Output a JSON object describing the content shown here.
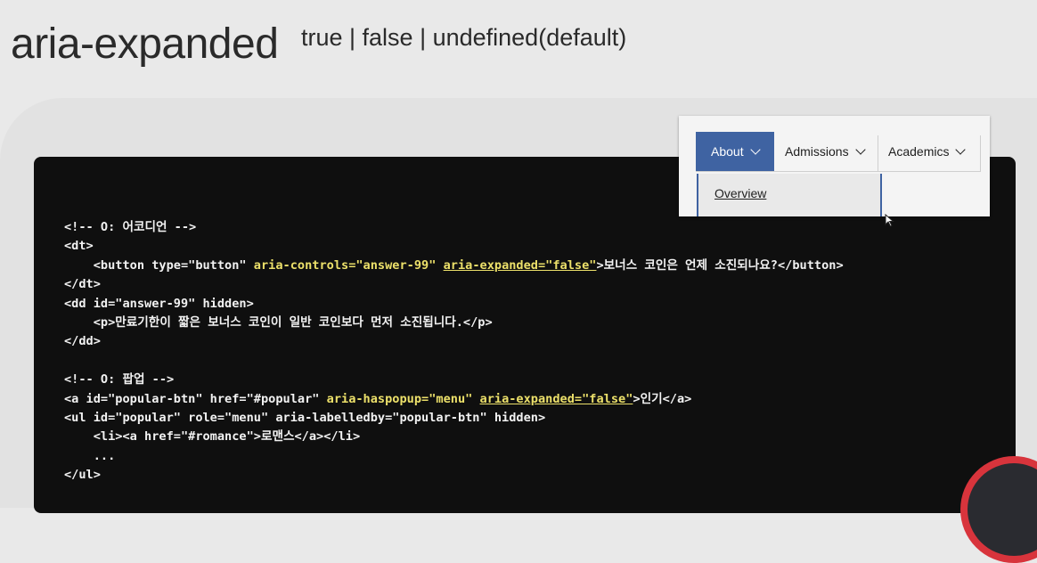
{
  "title": "aria-expanded",
  "subtitle": "true | false | undefined(default)",
  "demo": {
    "nav": [
      {
        "label": "About",
        "active": true
      },
      {
        "label": "Admissions",
        "active": false
      },
      {
        "label": "Academics",
        "active": false
      }
    ],
    "dropdown_item": "Overview",
    "colors": {
      "active": "#3f63a2"
    }
  },
  "code": {
    "l1": "<!-- O: 어코디언 -->",
    "l2": "<dt>",
    "l3_a": "    <button type=\"button\" ",
    "l3_b": "aria-controls=\"answer-99\"",
    "l3_c": " ",
    "l3_d": "aria-expanded=\"false\"",
    "l3_e": ">보너스 코인은 언제 소진되나요?</button>",
    "l4": "</dt>",
    "l5": "<dd id=\"answer-99\" hidden>",
    "l6": "    <p>만료기한이 짧은 보너스 코인이 일반 코인보다 먼저 소진됩니다.</p>",
    "l7": "</dd>",
    "l9": "<!-- O: 팝업 -->",
    "l10_a": "<a id=\"popular-btn\" href=\"#popular\" ",
    "l10_b": "aria-haspopup=\"menu\"",
    "l10_c": " ",
    "l10_d": "aria-expanded=\"false\"",
    "l10_e": ">인기</a>",
    "l11": "<ul id=\"popular\" role=\"menu\" aria-labelledby=\"popular-btn\" hidden>",
    "l12": "    <li><a href=\"#romance\">로맨스</a></li>",
    "l13": "    ...",
    "l14": "</ul>"
  }
}
